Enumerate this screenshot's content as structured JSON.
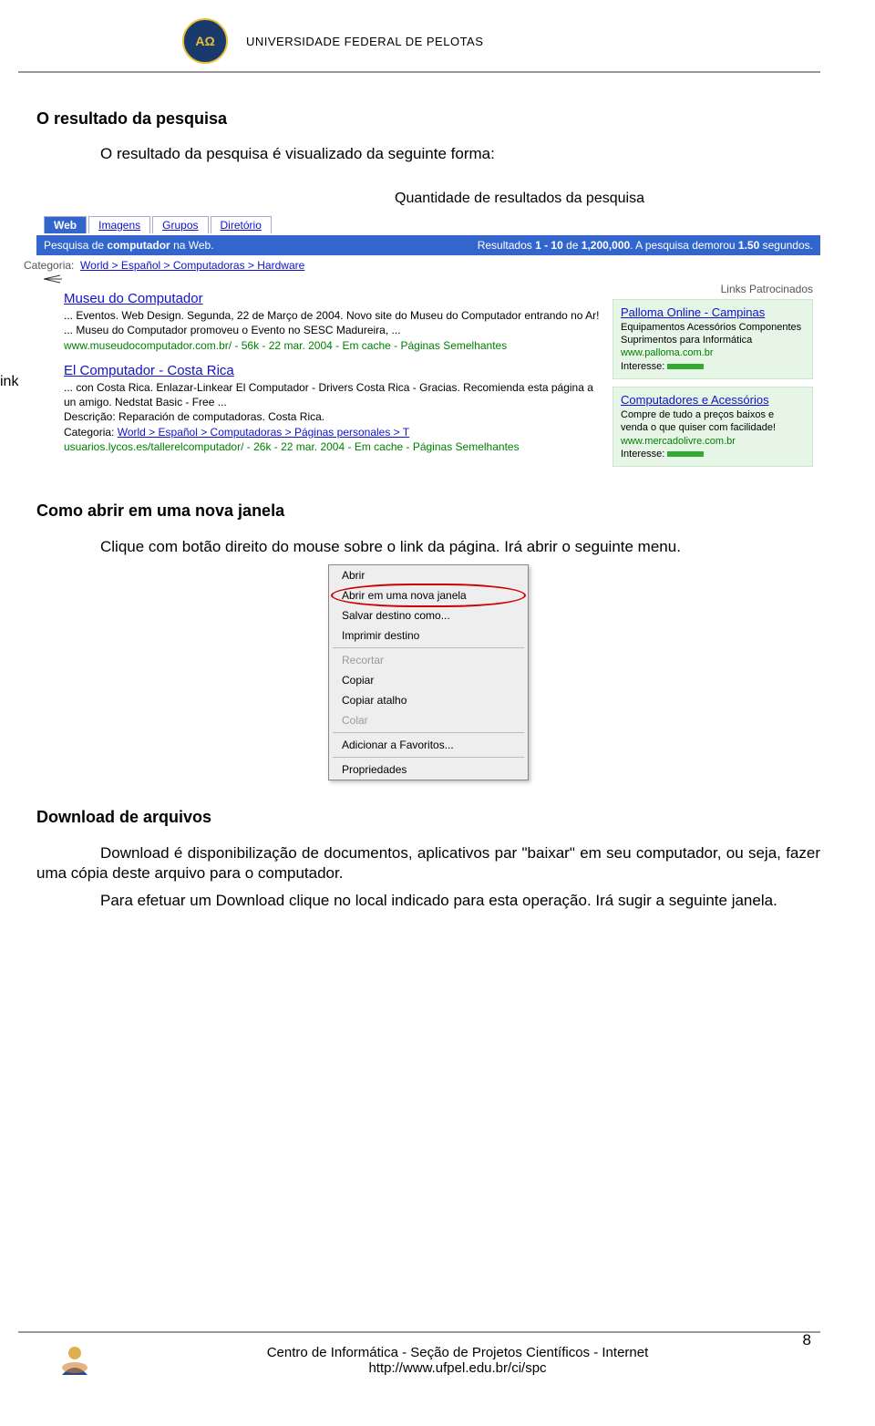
{
  "header": {
    "logo_text": "AΩ",
    "university": "UNIVERSIDADE FEDERAL DE PELOTAS"
  },
  "section1": {
    "heading": "O resultado da pesquisa",
    "intro": "O resultado da pesquisa é visualizado da seguinte forma:",
    "callout": "Quantidade de resultados da pesquisa",
    "side_label": "ink"
  },
  "serp": {
    "tabs": [
      "Web",
      "Imagens",
      "Grupos",
      "Diretório"
    ],
    "bar_left_prefix": "Pesquisa de ",
    "bar_left_term": "computador",
    "bar_left_suffix": " na Web.",
    "bar_right_prefix": "Resultados ",
    "bar_right_range": "1 - 10",
    "bar_right_of": " de ",
    "bar_right_total": "1,200,000",
    "bar_right_time_prefix": ". A pesquisa demorou ",
    "bar_right_time": "1.50",
    "bar_right_time_suffix": " segundos.",
    "category_label": "Categoria:",
    "category_path": "World > Español > Computadoras > Hardware",
    "results": [
      {
        "title": "Museu do Computador",
        "desc": "... Eventos. Web Design. Segunda, 22 de Março de 2004. Novo site do Museu do Computador entrando no Ar! ... Museu do Computador promoveu o Evento no SESC Madureira, ...",
        "meta": "www.museudocomputador.com.br/ - 56k - 22 mar. 2004 - Em cache - Páginas Semelhantes"
      },
      {
        "title": "El Computador - Costa Rica",
        "desc": "... con Costa Rica. Enlazar-Linkear El Computador - Drivers Costa Rica - Gracias. Recomienda esta página a un amigo. Nedstat Basic - Free ...",
        "extra1": "Descrição: Reparación de computadoras. Costa Rica.",
        "extra2_label": "Categoria:",
        "extra2_path": "World > Español > Computadoras > Páginas personales > T",
        "meta": "usuarios.lycos.es/tallerelcomputador/ - 26k - 22 mar. 2004 - Em cache - Páginas Semelhantes"
      }
    ],
    "sponsored_label": "Links Patrocinados",
    "sponsors": [
      {
        "title": "Palloma Online - Campinas",
        "lines": [
          "Equipamentos Acessórios Componentes",
          "Suprimentos para Informática"
        ],
        "link": "www.palloma.com.br",
        "interest": "Interesse:"
      },
      {
        "title": "Computadores e Acessórios",
        "lines": [
          "Compre de tudo a preços baixos e",
          "venda o que quiser com facilidade!"
        ],
        "link": "www.mercadolivre.com.br",
        "interest": "Interesse:"
      }
    ]
  },
  "section2": {
    "heading": "Como abrir em uma nova janela",
    "para": "Clique com botão direito do mouse sobre o link da página. Irá abrir o seguinte menu."
  },
  "context_menu": {
    "items": [
      {
        "label": "Abrir",
        "disabled": false
      },
      {
        "label": "Abrir em uma nova janela",
        "disabled": false,
        "highlight": true
      },
      {
        "label": "Salvar destino como...",
        "disabled": false
      },
      {
        "label": "Imprimir destino",
        "disabled": false
      },
      {
        "sep": true
      },
      {
        "label": "Recortar",
        "disabled": true
      },
      {
        "label": "Copiar",
        "disabled": false
      },
      {
        "label": "Copiar atalho",
        "disabled": false
      },
      {
        "label": "Colar",
        "disabled": true
      },
      {
        "sep": true
      },
      {
        "label": "Adicionar a Favoritos...",
        "disabled": false
      },
      {
        "sep": true
      },
      {
        "label": "Propriedades",
        "disabled": false
      }
    ]
  },
  "section3": {
    "heading": "Download de arquivos",
    "para1": "Download é disponibilização de documentos, aplicativos par \"baixar\" em seu computador, ou seja, fazer uma cópia deste arquivo para o computador.",
    "para2": "Para efetuar um Download clique no local indicado para esta operação. Irá sugir a seguinte janela."
  },
  "footer": {
    "line1": "Centro de Informática - Seção de Projetos Científicos - Internet",
    "line2": "http://www.ufpel.edu.br/ci/spc",
    "page_number": "8"
  }
}
